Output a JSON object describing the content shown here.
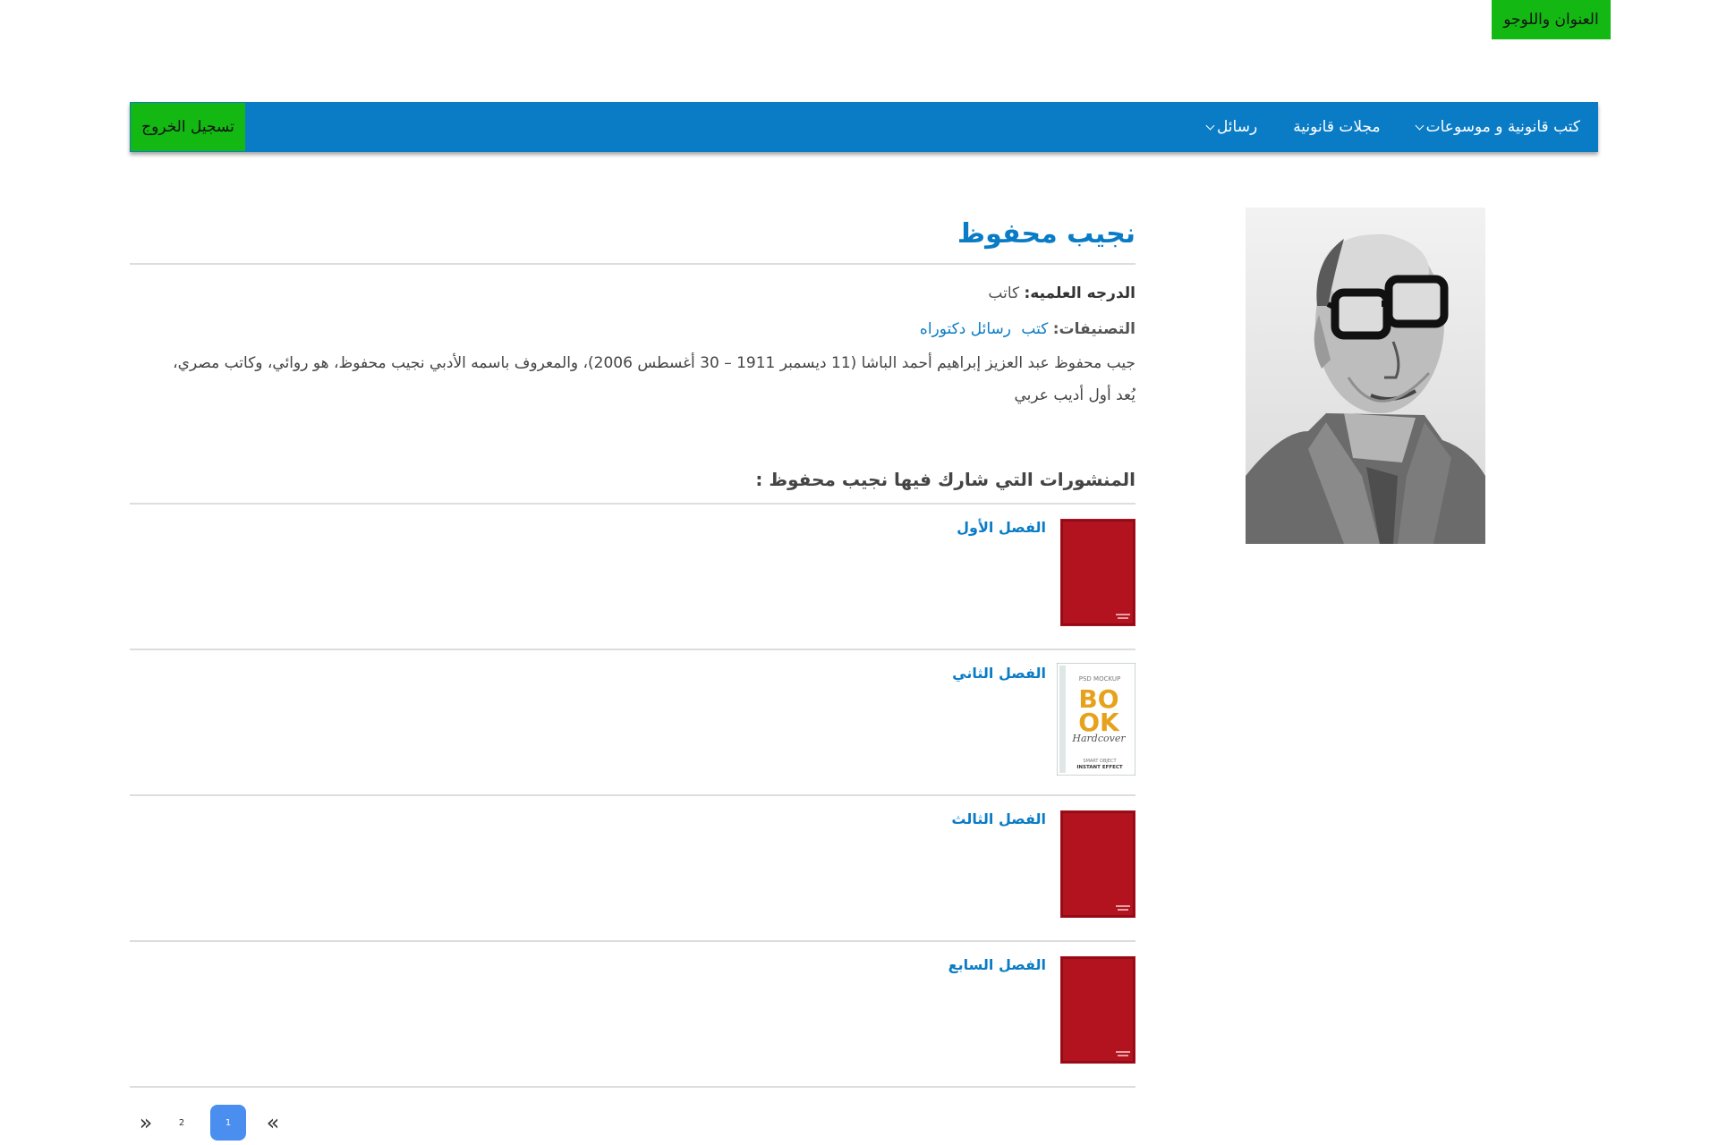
{
  "header": {
    "logo_text": "العنوان واللوجو"
  },
  "nav": {
    "items": [
      {
        "label": "كتب قانونية و موسوعات",
        "dropdown": true
      },
      {
        "label": "مجلات قانونية",
        "dropdown": false
      },
      {
        "label": "رسائل",
        "dropdown": true
      }
    ],
    "logout_label": "تسجيل الخروج"
  },
  "author": {
    "name": "نجيب محفوظ",
    "degree_label": "الدرجه العلميه:",
    "degree_value": "كاتب",
    "categories_label": "التصنيفات:",
    "categories": [
      "كتب",
      "رسائل دكتوراه"
    ],
    "bio_line1": "جيب محفوظ عبد العزيز إبراهيم أحمد الباشا (11 ديسمبر 1911 – 30 أغسطس 2006)، والمعروف باسمه الأدبي نجيب محفوظ، هو روائي، وكاتب مصري،",
    "bio_line2": "يُعد أول أديب عربي"
  },
  "publications": {
    "heading": "المنشورات التي شارك فيها نجيب محفوظ :",
    "items": [
      {
        "title": "الفصل الأول",
        "cover": "red"
      },
      {
        "title": "الفصل الثاني",
        "cover": "book"
      },
      {
        "title": "الفصل الثالث",
        "cover": "red"
      },
      {
        "title": "الفصل السابع",
        "cover": "red"
      }
    ],
    "book_cover_text": {
      "top": "PSD MOCKUP",
      "line1": "BO",
      "line2": "OK",
      "script": "Hardcover",
      "bottom1": "SMART OBJECT",
      "bottom2": "INSTANT EFFECT"
    }
  },
  "pagination": {
    "prev": "«",
    "next": "»",
    "pages": [
      "1",
      "2"
    ],
    "current": "1"
  },
  "colors": {
    "primary": "#0a7cc6",
    "accent_green": "#13b813",
    "active_page": "#4a8ef0"
  }
}
